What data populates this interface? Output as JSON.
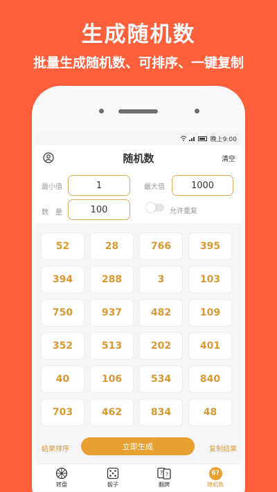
{
  "promo": {
    "title": "生成随机数",
    "subtitle": "批量生成随机数、可排序、一键复制"
  },
  "status_bar": {
    "time": "晚上9:00"
  },
  "app_bar": {
    "title": "随机数",
    "clear_label": "清空"
  },
  "controls": {
    "min_label": "最小值",
    "min_value": "1",
    "max_label": "最大值",
    "max_value": "1000",
    "count_label": "数　量",
    "count_value": "100",
    "allow_repeat_label": "允许重复",
    "allow_repeat_on": false
  },
  "results": [
    "52",
    "28",
    "766",
    "395",
    "394",
    "288",
    "3",
    "103",
    "750",
    "937",
    "482",
    "109",
    "352",
    "513",
    "202",
    "401",
    "40",
    "106",
    "534",
    "840",
    "703",
    "462",
    "834",
    "48"
  ],
  "actions": {
    "sort_label": "结果排序",
    "generate_label": "立即生成",
    "copy_label": "复制结果"
  },
  "tabs": [
    {
      "label": "转盘",
      "icon": "wheel-icon"
    },
    {
      "label": "骰子",
      "icon": "dice-icon"
    },
    {
      "label": "翻牌",
      "icon": "cards-icon"
    },
    {
      "label": "随机数",
      "icon": "random-number-icon",
      "badge": "6?",
      "active": true
    }
  ],
  "colors": {
    "background": "#ff5f3a",
    "accent": "#d99832",
    "button": "#e8a030"
  }
}
